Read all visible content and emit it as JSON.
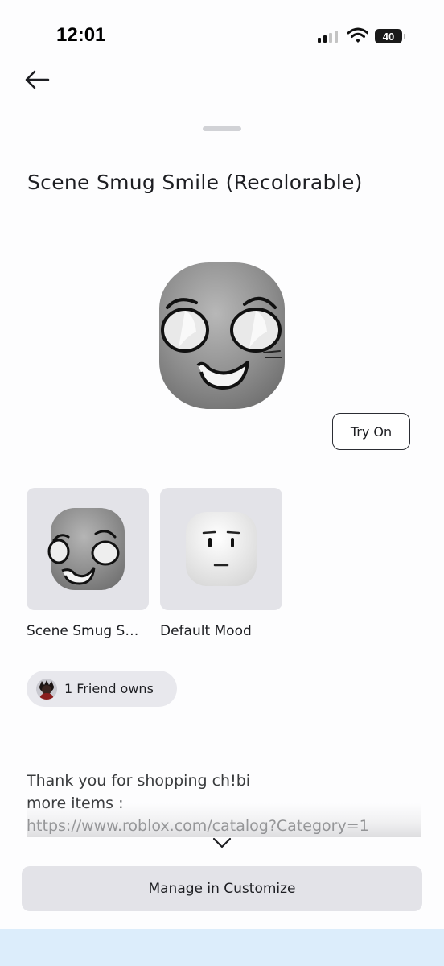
{
  "status_bar": {
    "time": "12:01",
    "battery": "40",
    "signal_icon": "cellular-signal-icon",
    "wifi_icon": "wifi-icon"
  },
  "header": {
    "back_icon": "arrow-left-icon"
  },
  "item": {
    "title": "Scene Smug Smile (Recolorable)",
    "try_on_label": "Try On"
  },
  "variants": [
    {
      "label": "Scene Smug S…",
      "selected": true
    },
    {
      "label": "Default Mood",
      "selected": false
    }
  ],
  "friends": {
    "label": "1 Friend owns"
  },
  "description": {
    "lines": [
      "Thank you for shopping ch!bi",
      "more items :",
      "https://www.roblox.com/catalog?Category=1"
    ],
    "expand_icon": "chevron-down-icon"
  },
  "actions": {
    "manage_label": "Manage in Customize"
  },
  "colors": {
    "background": "#fdfdfe",
    "card": "#e3e3e8",
    "text": "#1d1e22",
    "bottom_strip": "#dcedfb"
  }
}
